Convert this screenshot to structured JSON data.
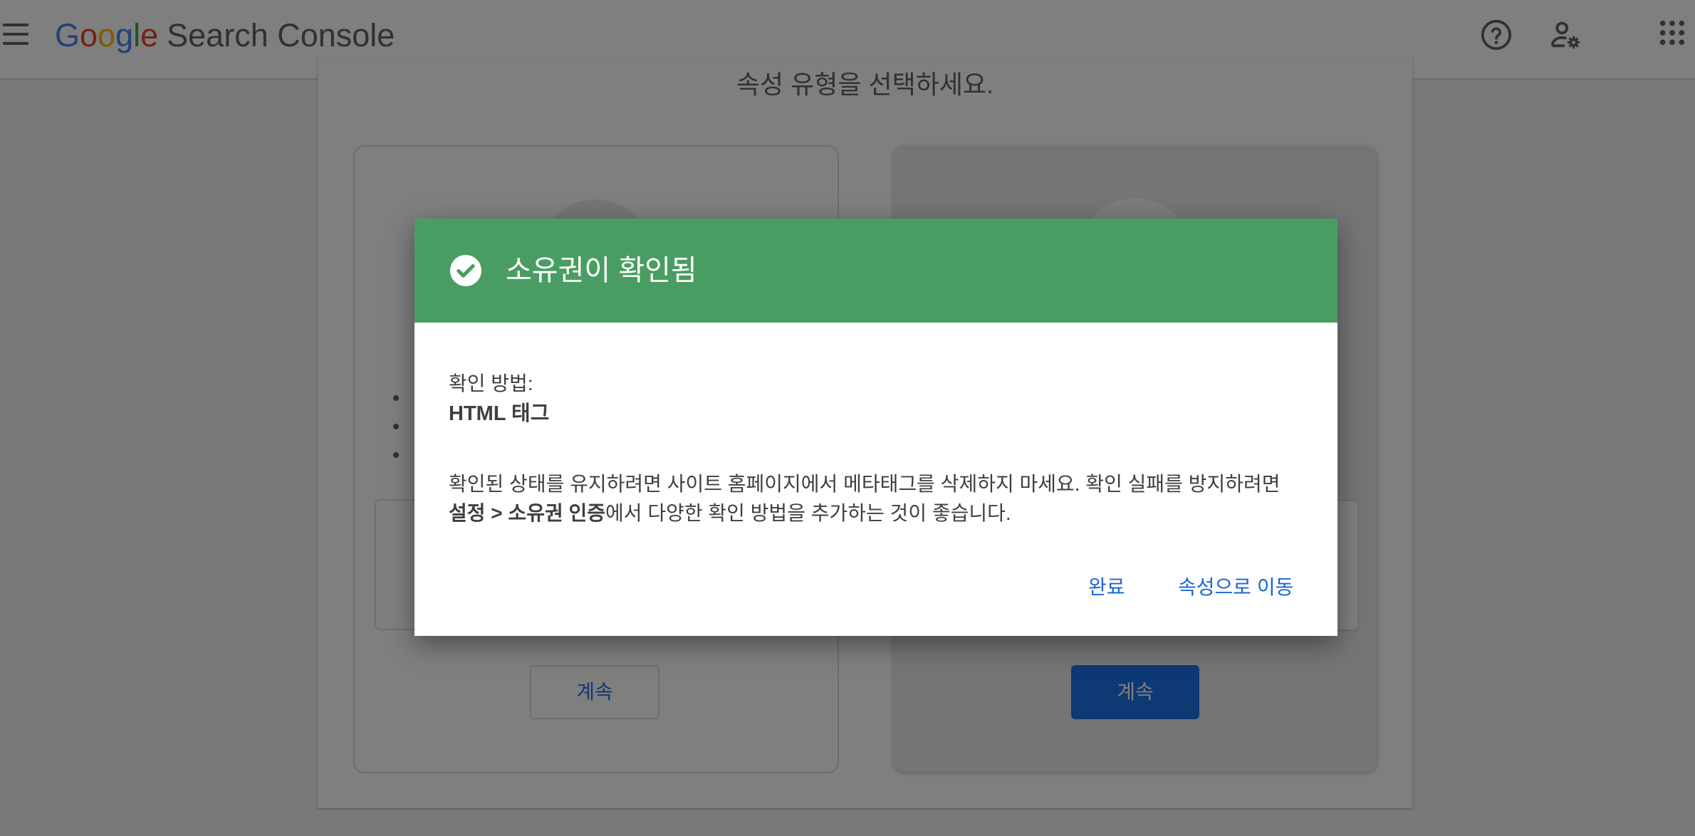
{
  "header": {
    "logo_letters": [
      "G",
      "o",
      "o",
      "g",
      "l",
      "e"
    ],
    "product": "Search Console",
    "menu_icon": "menu-icon",
    "help_icon": "help-circle-icon",
    "admin_icon": "admin-settings-icon",
    "apps_icon": "apps-grid-icon"
  },
  "background": {
    "subtitle": "속성 유형을 선택하세요.",
    "left_card": {
      "continue_label": "계속"
    },
    "right_card": {
      "continue_label": "계속"
    }
  },
  "dialog": {
    "title": "소유권이 확인됨",
    "title_icon": "check-circle-icon",
    "header_color": "#4a9d62",
    "method_label": "확인 방법:",
    "method_value": "HTML 태그",
    "description_part1": "확인된 상태를 유지하려면 사이트 홈페이지에서 메타태그를 삭제하지 마세요. 확인 실패를 방지하려면 ",
    "description_bold": "설정 > 소유권 인증",
    "description_part2": "에서 다양한 확인 방법을 추가하는 것이 좋습니다.",
    "done_label": "완료",
    "go_to_property_label": "속성으로 이동"
  }
}
